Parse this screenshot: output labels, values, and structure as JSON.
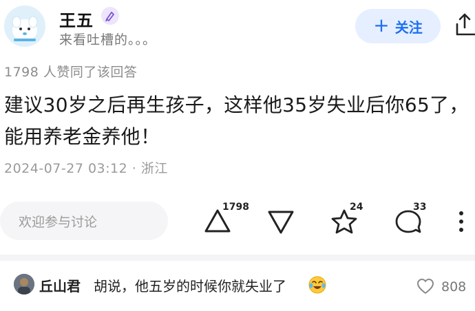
{
  "header": {
    "author_name": "王五",
    "author_bio": "来看吐槽的。。。",
    "follow_label": "关注",
    "follow_plus": "+"
  },
  "answer": {
    "likes_text": "1798 人赞同了该回答",
    "content": "建议30岁之后再生孩子，这样他35岁失业后你65了，能用养老金养他！",
    "meta": "2024-07-27 03:12 · 浙江"
  },
  "action_bar": {
    "comment_placeholder": "欢迎参与讨论",
    "upvote_count": "1798",
    "favorite_count": "24",
    "comment_count": "33"
  },
  "comment": {
    "username": "丘山君",
    "text": "胡说，他五岁的时候你就失业了",
    "like_count": "808"
  },
  "colors": {
    "accent_blue": "#1c6ff2",
    "follow_bg": "#e5efff",
    "muted_text": "#8c8c8c"
  },
  "icons": [
    "share-icon",
    "upvote-icon",
    "downvote-icon",
    "star-icon",
    "comment-icon",
    "more-icon",
    "heart-icon",
    "laughing-crying-emoji"
  ]
}
